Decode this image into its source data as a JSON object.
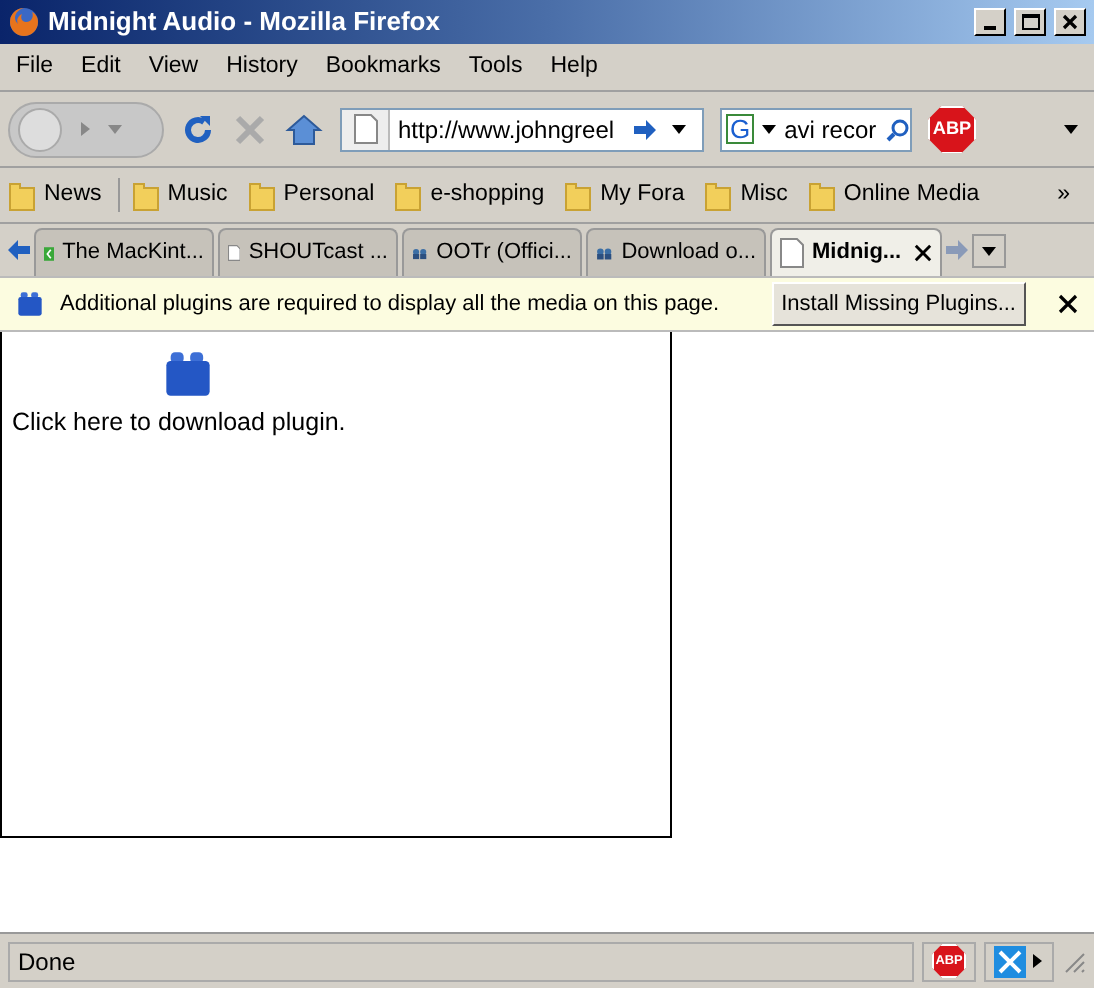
{
  "window": {
    "title": "Midnight Audio - Mozilla Firefox"
  },
  "menu": [
    "File",
    "Edit",
    "View",
    "History",
    "Bookmarks",
    "Tools",
    "Help"
  ],
  "toolbar": {
    "url": "http://www.johngreel",
    "search": "avi recor",
    "search_engine": "G",
    "adblock": "ABP"
  },
  "bookmarks": [
    {
      "label": "News"
    },
    {
      "label": "Music"
    },
    {
      "label": "Personal"
    },
    {
      "label": "e-shopping"
    },
    {
      "label": "My Fora"
    },
    {
      "label": "Misc"
    },
    {
      "label": "Online Media"
    }
  ],
  "bookmarks_overflow": "»",
  "tabs": [
    {
      "label": "The MacKint...",
      "kind": "green",
      "selected": false
    },
    {
      "label": "SHOUTcast ...",
      "kind": "page",
      "selected": false
    },
    {
      "label": "OOTr (Offici...",
      "kind": "people",
      "selected": false
    },
    {
      "label": "Download o...",
      "kind": "people",
      "selected": false
    },
    {
      "label": "Midnig...",
      "kind": "page",
      "selected": true
    }
  ],
  "notification": {
    "message": "Additional plugins are required to display all the media on this page.",
    "button": "Install Missing Plugins..."
  },
  "plugin": {
    "label": "Click here to download plugin."
  },
  "status_bar": {
    "text": "Done",
    "adblock": "ABP"
  }
}
